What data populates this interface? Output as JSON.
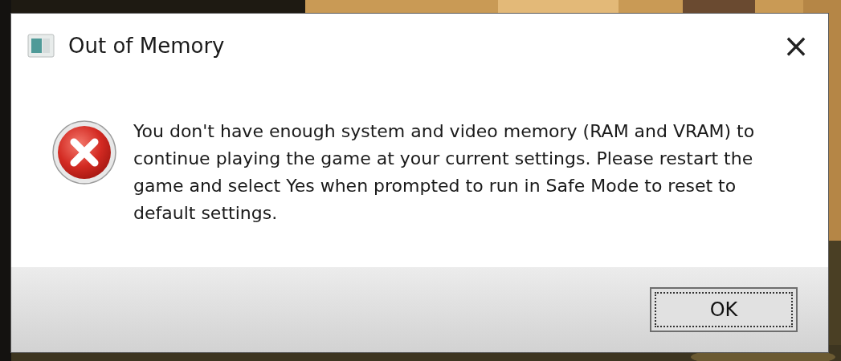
{
  "dialog": {
    "title": "Out of Memory",
    "close": "×",
    "message": "You don't have enough system and video memory (RAM and VRAM) to continue playing the game at your current settings. Please restart the game and select Yes when prompted to run in Safe Mode to reset to default settings.",
    "buttons": [
      "OK"
    ]
  }
}
